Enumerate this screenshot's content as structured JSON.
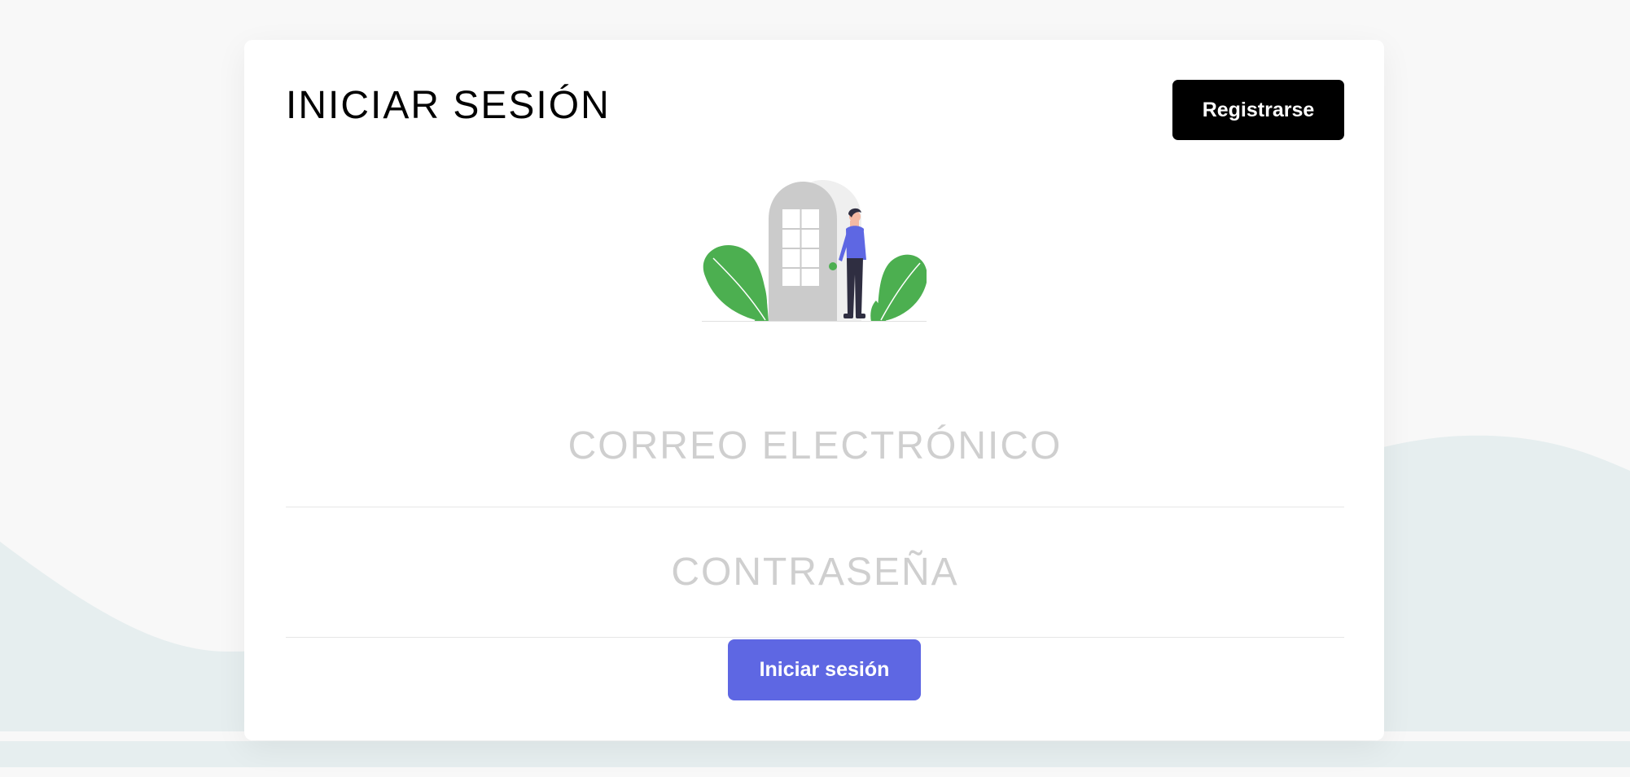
{
  "header": {
    "title": "INICIAR SESIÓN",
    "register_label": "Registrarse"
  },
  "form": {
    "email_placeholder": "CORREO ELECTRÓNICO",
    "email_value": "",
    "password_placeholder": "CONTRASEÑA",
    "password_value": "",
    "submit_label": "Iniciar sesión"
  },
  "illustration": {
    "icon": "person-opening-door-illustration"
  },
  "colors": {
    "primary_button": "#5e67e3",
    "secondary_button": "#000000",
    "plant": "#4caf50",
    "person_shirt": "#5e67e3",
    "door": "#cbcbcb",
    "background_wave": "#e6eeef"
  }
}
